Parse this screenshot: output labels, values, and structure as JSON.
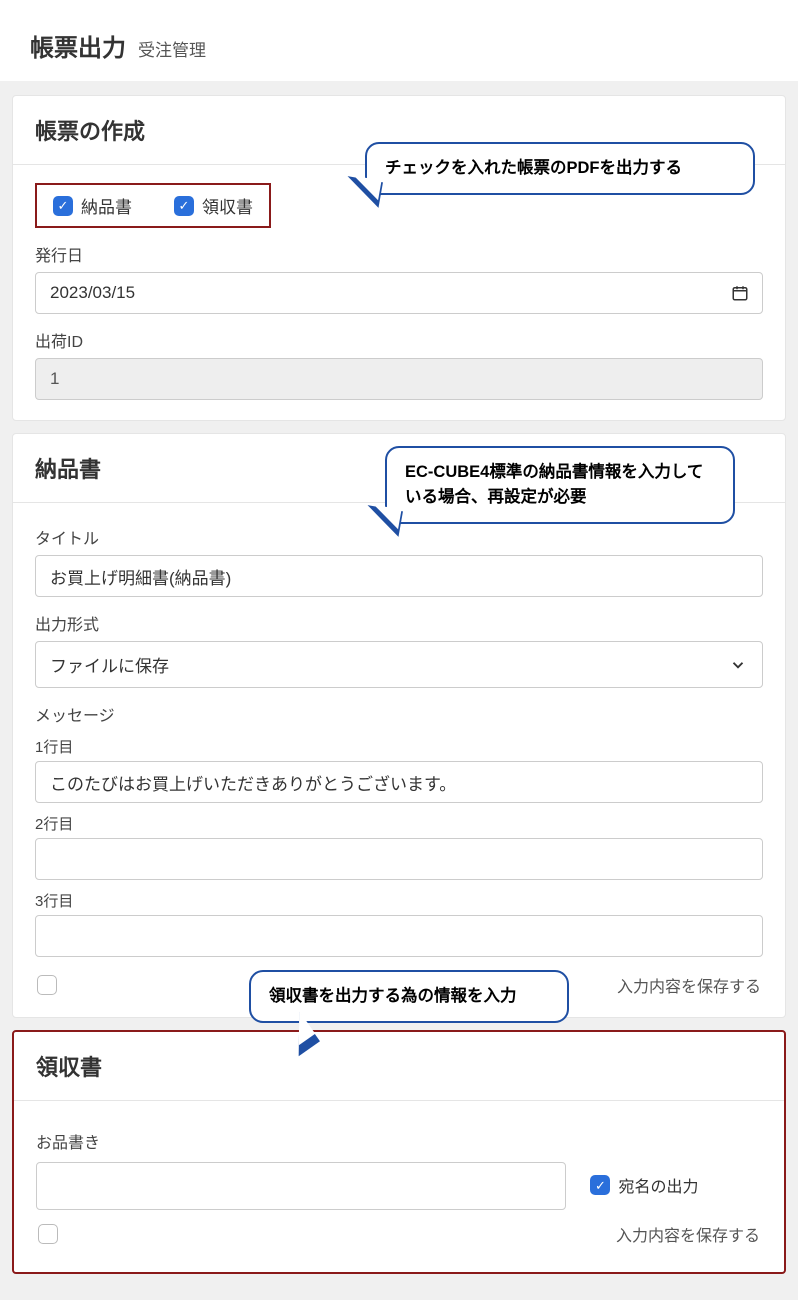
{
  "header": {
    "title": "帳票出力",
    "subtitle": "受注管理"
  },
  "creation": {
    "heading": "帳票の作成",
    "checks": {
      "delivery_slip": "納品書",
      "receipt": "領収書"
    },
    "issue_date_label": "発行日",
    "issue_date_value": "2023/03/15",
    "shipping_id_label": "出荷ID",
    "shipping_id_value": "1"
  },
  "delivery": {
    "heading": "納品書",
    "title_label": "タイトル",
    "title_value": "お買上げ明細書(納品書)",
    "output_label": "出力形式",
    "output_value": "ファイルに保存",
    "message_label": "メッセージ",
    "line1_label": "1行目",
    "line1_value": "このたびはお買上げいただきありがとうございます。",
    "line2_label": "2行目",
    "line2_value": "",
    "line3_label": "3行目",
    "line3_value": "",
    "save_label": "入力内容を保存する"
  },
  "receipt": {
    "heading": "領収書",
    "item_label": "お品書き",
    "item_value": "",
    "addressee_label": "宛名の出力",
    "save_label": "入力内容を保存する"
  },
  "callouts": {
    "c1": "チェックを入れた帳票のPDFを出力する",
    "c2": "EC-CUBE4標準の納品書情報を入力している場合、再設定が必要",
    "c3": "領収書を出力する為の情報を入力"
  }
}
